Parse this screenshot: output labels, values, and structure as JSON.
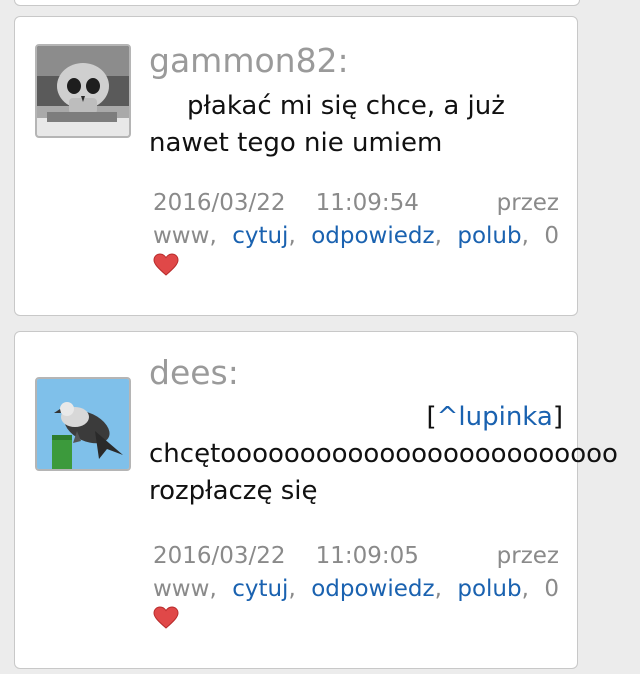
{
  "comments": [
    {
      "username": "gammon82:",
      "text": "płakać mi się chce, a już nawet tego nie umiem",
      "date": "2016/03/22",
      "time": "11:09:54",
      "by_label": "przez",
      "source": "www",
      "quote_label": "cytuj",
      "reply_label": "odpowiedz",
      "like_label": "polub",
      "like_count": "0"
    },
    {
      "username": "dees:",
      "quote_prefix": "[",
      "quote_ref": "^lupinka",
      "quote_suffix": "]",
      "text_line1": "chcętooooooooooooooooooooooooo",
      "text_line2": "rozpłaczę się",
      "date": "2016/03/22",
      "time": "11:09:05",
      "by_label": "przez",
      "source": "www",
      "quote_label": "cytuj",
      "reply_label": "odpowiedz",
      "like_label": "polub",
      "like_count": "0"
    }
  ],
  "colors": {
    "link": "#1a62b0",
    "username": "#9a9a9a",
    "meta": "#8a8a8a",
    "heart": "#e04848"
  }
}
